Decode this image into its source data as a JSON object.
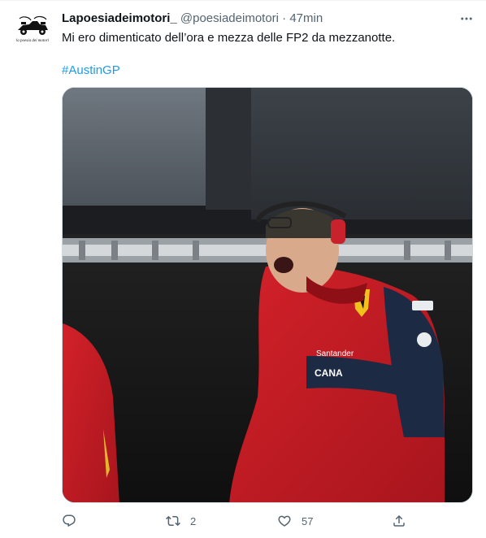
{
  "tweet": {
    "author_name": "Lapoesiadeimotori_",
    "handle": "@poesiadeimotori",
    "separator": "·",
    "time": "47min",
    "text": "Mi ero dimenticato dell’ora e mezza delle FP2 da mezzanotte.",
    "hashtag": "#AustinGP",
    "avatar_caption": "la poesia dei motori",
    "media_sponsor_text": "Santander",
    "media_brand_text": "CANA",
    "actions": {
      "reply_count": "",
      "retweet_count": "2",
      "like_count": "57"
    },
    "icons": [
      "more-icon",
      "reply-icon",
      "retweet-icon",
      "like-icon",
      "share-icon"
    ]
  }
}
